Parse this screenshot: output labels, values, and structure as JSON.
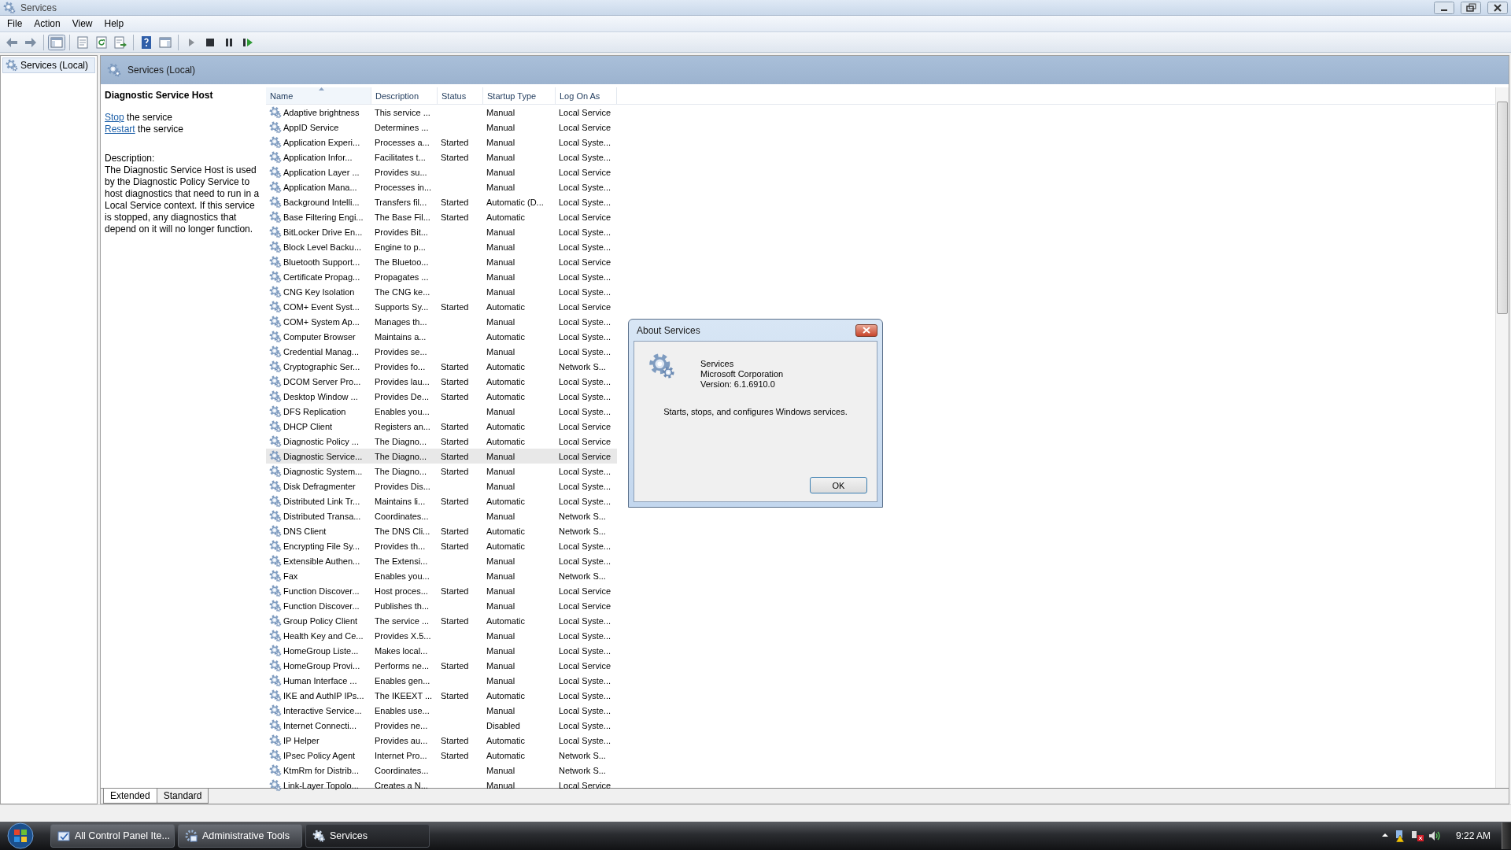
{
  "window": {
    "title": "Services",
    "controls": [
      {
        "kind": "minimize"
      },
      {
        "kind": "restore"
      },
      {
        "kind": "close"
      }
    ]
  },
  "menu": [
    "File",
    "Action",
    "View",
    "Help"
  ],
  "toolbar": {
    "groups": [
      [
        {
          "kind": "back",
          "pressed": false
        },
        {
          "kind": "forward",
          "pressed": false
        }
      ],
      [
        {
          "kind": "console-tree",
          "pressed": true
        }
      ],
      [
        {
          "kind": "properties",
          "pressed": false
        },
        {
          "kind": "refresh",
          "pressed": false
        },
        {
          "kind": "export",
          "pressed": false
        }
      ],
      [
        {
          "kind": "help",
          "pressed": false
        },
        {
          "kind": "action-pane",
          "pressed": false
        }
      ],
      [
        {
          "kind": "start",
          "pressed": false
        },
        {
          "kind": "stop",
          "pressed": false
        },
        {
          "kind": "pause",
          "pressed": false
        },
        {
          "kind": "restart",
          "pressed": false
        }
      ]
    ]
  },
  "tree": {
    "items": [
      {
        "label": "Services (Local)",
        "selected": true
      }
    ]
  },
  "panel": {
    "title": "Services (Local)"
  },
  "details": {
    "title": "Diagnostic Service Host",
    "actions": [
      {
        "link": "Stop",
        "text": "the service"
      },
      {
        "link": "Restart",
        "text": "the service"
      }
    ],
    "description_label": "Description:",
    "description": "The Diagnostic Service Host is used by the Diagnostic Policy Service to host diagnostics that need to run in a Local Service context.  If this service is stopped, any diagnostics that depend on it will no longer function."
  },
  "table": {
    "columns": [
      {
        "label": "Name",
        "sorted": true
      },
      {
        "label": "Description",
        "sorted": false
      },
      {
        "label": "Status",
        "sorted": false
      },
      {
        "label": "Startup Type",
        "sorted": false
      },
      {
        "label": "Log On As",
        "sorted": false
      }
    ],
    "rows": [
      {
        "name": "Adaptive brightness",
        "description": "This service ...",
        "startup_type": "Manual",
        "log_on_as": "Local Service",
        "selected": false
      },
      {
        "name": "AppID Service",
        "description": "Determines ...",
        "startup_type": "Manual",
        "log_on_as": "Local Service",
        "selected": false
      },
      {
        "name": "Application Experi...",
        "description": "Processes a...",
        "status": "Started",
        "startup_type": "Manual",
        "log_on_as": "Local Syste...",
        "selected": false
      },
      {
        "name": "Application Infor...",
        "description": "Facilitates t...",
        "status": "Started",
        "startup_type": "Manual",
        "log_on_as": "Local Syste...",
        "selected": false
      },
      {
        "name": "Application Layer ...",
        "description": "Provides su...",
        "startup_type": "Manual",
        "log_on_as": "Local Service",
        "selected": false
      },
      {
        "name": "Application Mana...",
        "description": "Processes in...",
        "startup_type": "Manual",
        "log_on_as": "Local Syste...",
        "selected": false
      },
      {
        "name": "Background Intelli...",
        "description": "Transfers fil...",
        "status": "Started",
        "startup_type": "Automatic (D...",
        "log_on_as": "Local Syste...",
        "selected": false
      },
      {
        "name": "Base Filtering Engi...",
        "description": "The Base Fil...",
        "status": "Started",
        "startup_type": "Automatic",
        "log_on_as": "Local Service",
        "selected": false
      },
      {
        "name": "BitLocker Drive En...",
        "description": "Provides Bit...",
        "startup_type": "Manual",
        "log_on_as": "Local Syste...",
        "selected": false
      },
      {
        "name": "Block Level Backu...",
        "description": "Engine to p...",
        "startup_type": "Manual",
        "log_on_as": "Local Syste...",
        "selected": false
      },
      {
        "name": "Bluetooth Support...",
        "description": "The Bluetoo...",
        "startup_type": "Manual",
        "log_on_as": "Local Service",
        "selected": false
      },
      {
        "name": "Certificate Propag...",
        "description": "Propagates ...",
        "startup_type": "Manual",
        "log_on_as": "Local Syste...",
        "selected": false
      },
      {
        "name": "CNG Key Isolation",
        "description": "The CNG ke...",
        "startup_type": "Manual",
        "log_on_as": "Local Syste...",
        "selected": false
      },
      {
        "name": "COM+ Event Syst...",
        "description": "Supports Sy...",
        "status": "Started",
        "startup_type": "Automatic",
        "log_on_as": "Local Service",
        "selected": false
      },
      {
        "name": "COM+ System Ap...",
        "description": "Manages th...",
        "startup_type": "Manual",
        "log_on_as": "Local Syste...",
        "selected": false
      },
      {
        "name": "Computer Browser",
        "description": "Maintains a...",
        "startup_type": "Automatic",
        "log_on_as": "Local Syste...",
        "selected": false
      },
      {
        "name": "Credential Manag...",
        "description": "Provides se...",
        "startup_type": "Manual",
        "log_on_as": "Local Syste...",
        "selected": false
      },
      {
        "name": "Cryptographic Ser...",
        "description": "Provides fo...",
        "status": "Started",
        "startup_type": "Automatic",
        "log_on_as": "Network S...",
        "selected": false
      },
      {
        "name": "DCOM Server Pro...",
        "description": "Provides lau...",
        "status": "Started",
        "startup_type": "Automatic",
        "log_on_as": "Local Syste...",
        "selected": false
      },
      {
        "name": "Desktop Window ...",
        "description": "Provides De...",
        "status": "Started",
        "startup_type": "Automatic",
        "log_on_as": "Local Syste...",
        "selected": false
      },
      {
        "name": "DFS Replication",
        "description": "Enables you...",
        "startup_type": "Manual",
        "log_on_as": "Local Syste...",
        "selected": false
      },
      {
        "name": "DHCP Client",
        "description": "Registers an...",
        "status": "Started",
        "startup_type": "Automatic",
        "log_on_as": "Local Service",
        "selected": false
      },
      {
        "name": "Diagnostic Policy ...",
        "description": "The Diagno...",
        "status": "Started",
        "startup_type": "Automatic",
        "log_on_as": "Local Service",
        "selected": false
      },
      {
        "name": "Diagnostic Service...",
        "description": "The Diagno...",
        "status": "Started",
        "startup_type": "Manual",
        "log_on_as": "Local Service",
        "selected": true
      },
      {
        "name": "Diagnostic System...",
        "description": "The Diagno...",
        "status": "Started",
        "startup_type": "Manual",
        "log_on_as": "Local Syste...",
        "selected": false
      },
      {
        "name": "Disk Defragmenter",
        "description": "Provides Dis...",
        "startup_type": "Manual",
        "log_on_as": "Local Syste...",
        "selected": false
      },
      {
        "name": "Distributed Link Tr...",
        "description": "Maintains li...",
        "status": "Started",
        "startup_type": "Automatic",
        "log_on_as": "Local Syste...",
        "selected": false
      },
      {
        "name": "Distributed Transa...",
        "description": "Coordinates...",
        "startup_type": "Manual",
        "log_on_as": "Network S...",
        "selected": false
      },
      {
        "name": "DNS Client",
        "description": "The DNS Cli...",
        "status": "Started",
        "startup_type": "Automatic",
        "log_on_as": "Network S...",
        "selected": false
      },
      {
        "name": "Encrypting File Sy...",
        "description": "Provides th...",
        "status": "Started",
        "startup_type": "Automatic",
        "log_on_as": "Local Syste...",
        "selected": false
      },
      {
        "name": "Extensible Authen...",
        "description": "The Extensi...",
        "startup_type": "Manual",
        "log_on_as": "Local Syste...",
        "selected": false
      },
      {
        "name": "Fax",
        "description": "Enables you...",
        "startup_type": "Manual",
        "log_on_as": "Network S...",
        "selected": false
      },
      {
        "name": "Function Discover...",
        "description": "Host proces...",
        "status": "Started",
        "startup_type": "Manual",
        "log_on_as": "Local Service",
        "selected": false
      },
      {
        "name": "Function Discover...",
        "description": "Publishes th...",
        "startup_type": "Manual",
        "log_on_as": "Local Service",
        "selected": false
      },
      {
        "name": "Group Policy Client",
        "description": "The service ...",
        "status": "Started",
        "startup_type": "Automatic",
        "log_on_as": "Local Syste...",
        "selected": false
      },
      {
        "name": "Health Key and Ce...",
        "description": "Provides X.5...",
        "startup_type": "Manual",
        "log_on_as": "Local Syste...",
        "selected": false
      },
      {
        "name": "HomeGroup Liste...",
        "description": "Makes local...",
        "startup_type": "Manual",
        "log_on_as": "Local Syste...",
        "selected": false
      },
      {
        "name": "HomeGroup Provi...",
        "description": "Performs ne...",
        "status": "Started",
        "startup_type": "Manual",
        "log_on_as": "Local Service",
        "selected": false
      },
      {
        "name": "Human Interface ...",
        "description": "Enables gen...",
        "startup_type": "Manual",
        "log_on_as": "Local Syste...",
        "selected": false
      },
      {
        "name": "IKE and AuthIP IPs...",
        "description": "The IKEEXT ...",
        "status": "Started",
        "startup_type": "Automatic",
        "log_on_as": "Local Syste...",
        "selected": false
      },
      {
        "name": "Interactive Service...",
        "description": "Enables use...",
        "startup_type": "Manual",
        "log_on_as": "Local Syste...",
        "selected": false
      },
      {
        "name": "Internet Connecti...",
        "description": "Provides ne...",
        "startup_type": "Disabled",
        "log_on_as": "Local Syste...",
        "selected": false
      },
      {
        "name": "IP Helper",
        "description": "Provides au...",
        "status": "Started",
        "startup_type": "Automatic",
        "log_on_as": "Local Syste...",
        "selected": false
      },
      {
        "name": "IPsec Policy Agent",
        "description": "Internet Pro...",
        "status": "Started",
        "startup_type": "Automatic",
        "log_on_as": "Network S...",
        "selected": false
      },
      {
        "name": "KtmRm for Distrib...",
        "description": "Coordinates...",
        "startup_type": "Manual",
        "log_on_as": "Network S...",
        "selected": false
      },
      {
        "name": "Link-Layer Topolo...",
        "description": "Creates a N...",
        "startup_type": "Manual",
        "log_on_as": "Local Service",
        "selected": false
      }
    ]
  },
  "view_tabs": [
    {
      "label": "Extended",
      "selected": true
    },
    {
      "label": "Standard",
      "selected": false
    }
  ],
  "dialog": {
    "title": "About Services",
    "product": "Services",
    "company": "Microsoft Corporation",
    "version": "Version: 6.1.6910.0",
    "description": "Starts, stops, and configures Windows services.",
    "button": "OK"
  },
  "taskbar": {
    "buttons": [
      {
        "label": "All Control Panel Ite...",
        "kind": "control-panel",
        "selected": false
      },
      {
        "label": "Administrative Tools",
        "kind": "admin-tools",
        "selected": false
      },
      {
        "label": "Services",
        "kind": "services",
        "selected": true
      }
    ],
    "tray": [
      {
        "kind": "caret"
      },
      {
        "kind": "action-center"
      },
      {
        "kind": "network"
      },
      {
        "kind": "volume"
      }
    ],
    "clock": "9:22 AM"
  }
}
